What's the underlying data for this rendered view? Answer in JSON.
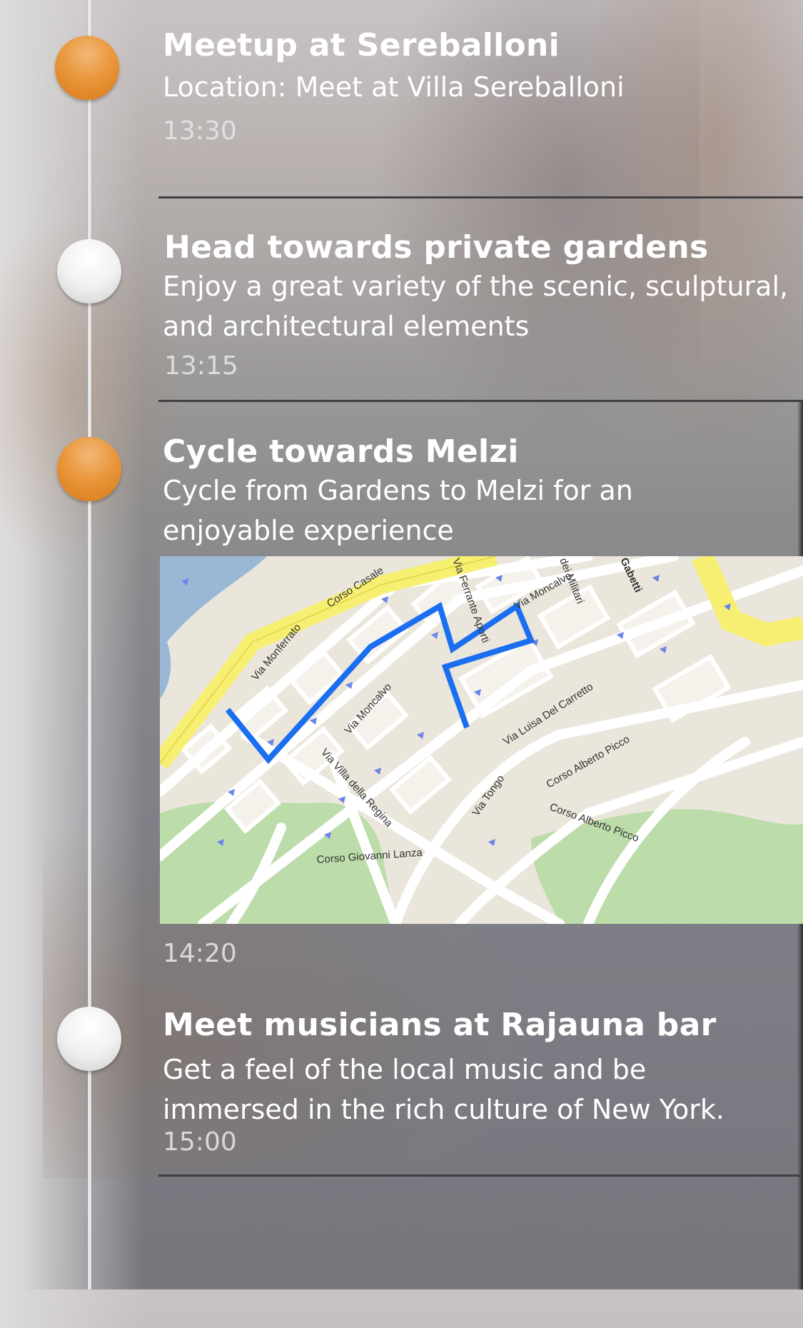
{
  "events": [
    {
      "title": "Meetup at Sereballoni",
      "description": "Location: Meet at Villa Sereballoni",
      "time": "13:30",
      "status": "highlighted",
      "dot_color": "#e38a27"
    },
    {
      "title": "Head towards private gardens",
      "description_lines": [
        "Enjoy a great variety of the scenic, sculptural,",
        "and architectural elements"
      ],
      "time": "13:15",
      "status": "normal",
      "dot_color": "#f4f4f4"
    },
    {
      "title": "Cycle towards Melzi",
      "description_lines": [
        "Cycle from Gardens to Melzi for an",
        "enjoyable experience"
      ],
      "time": "14:20",
      "status": "highlighted",
      "dot_color": "#e38a27",
      "map": {
        "streets": [
          "Corso Casale",
          "Via Monferrato",
          "Via Moncalvo",
          "Via Ferrante Aporti",
          "Via Moncalvo",
          "dei Militari",
          "Gabetti",
          "Via Luisa Del Carretto",
          "Via Villa della Regina",
          "Via Tongo",
          "Corso Alberto Picco",
          "Corso Alberto Picco",
          "Corso Giovanni Lanza"
        ],
        "route_color": "#1a6ff0",
        "road_major_color": "#f7ef72",
        "park_color": "#bcdcaa",
        "water_color": "#9ab8d6"
      }
    },
    {
      "title": "Meet musicians at Rajauna bar",
      "description_lines": [
        "Get a feel of the local music and be",
        "immersed in the rich culture of New York."
      ],
      "time": "15:00",
      "status": "normal",
      "dot_color": "#f4f4f4"
    }
  ]
}
